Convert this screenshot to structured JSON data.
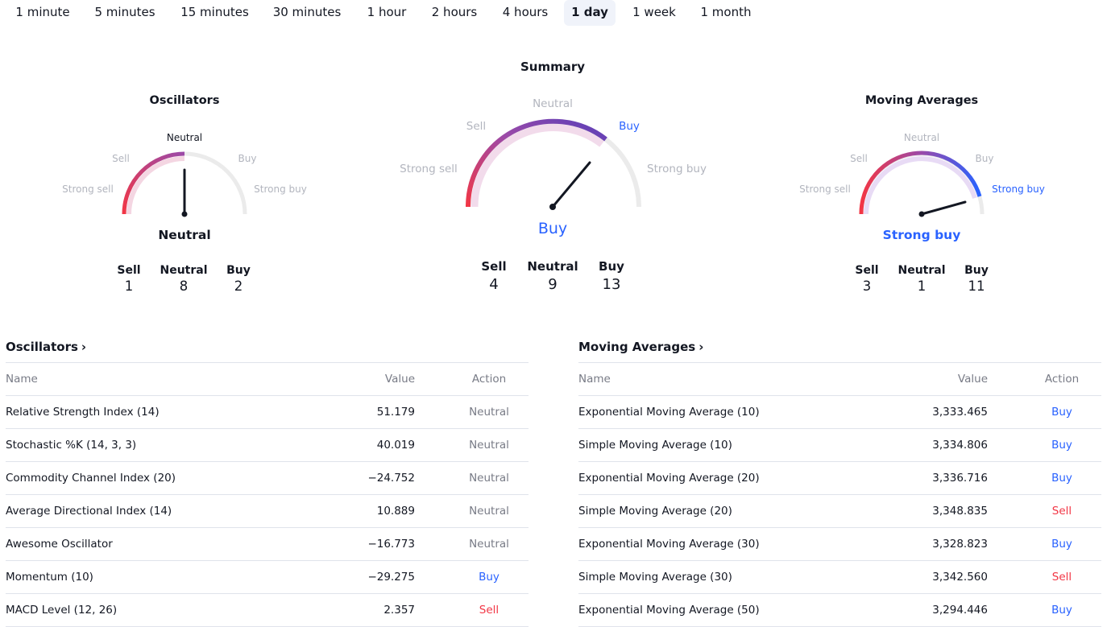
{
  "timeframes": {
    "items": [
      "1 minute",
      "5 minutes",
      "15 minutes",
      "30 minutes",
      "1 hour",
      "2 hours",
      "4 hours",
      "1 day",
      "1 week",
      "1 month"
    ],
    "active": "1 day"
  },
  "gauges": {
    "oscillators": {
      "title": "Oscillators",
      "labels": {
        "strong_sell": "Strong sell",
        "sell": "Sell",
        "neutral": "Neutral",
        "buy": "Buy",
        "strong_buy": "Strong buy"
      },
      "verdict": "Neutral",
      "counts": {
        "sell_label": "Sell",
        "neutral_label": "Neutral",
        "buy_label": "Buy",
        "sell": "1",
        "neutral": "8",
        "buy": "2"
      }
    },
    "summary": {
      "title": "Summary",
      "labels": {
        "strong_sell": "Strong sell",
        "sell": "Sell",
        "neutral": "Neutral",
        "buy": "Buy",
        "strong_buy": "Strong buy"
      },
      "verdict": "Buy",
      "counts": {
        "sell_label": "Sell",
        "neutral_label": "Neutral",
        "buy_label": "Buy",
        "sell": "4",
        "neutral": "9",
        "buy": "13"
      }
    },
    "moving_averages": {
      "title": "Moving Averages",
      "labels": {
        "strong_sell": "Strong sell",
        "sell": "Sell",
        "neutral": "Neutral",
        "buy": "Buy",
        "strong_buy": "Strong buy"
      },
      "verdict": "Strong buy",
      "counts": {
        "sell_label": "Sell",
        "neutral_label": "Neutral",
        "buy_label": "Buy",
        "sell": "3",
        "neutral": "1",
        "buy": "11"
      }
    }
  },
  "oscillators_table": {
    "title": "Oscillators",
    "chevron": "›",
    "headers": {
      "name": "Name",
      "value": "Value",
      "action": "Action"
    },
    "rows": [
      {
        "name": "Relative Strength Index (14)",
        "value": "51.179",
        "action": "Neutral"
      },
      {
        "name": "Stochastic %K (14, 3, 3)",
        "value": "40.019",
        "action": "Neutral"
      },
      {
        "name": "Commodity Channel Index (20)",
        "value": "−24.752",
        "action": "Neutral"
      },
      {
        "name": "Average Directional Index (14)",
        "value": "10.889",
        "action": "Neutral"
      },
      {
        "name": "Awesome Oscillator",
        "value": "−16.773",
        "action": "Neutral"
      },
      {
        "name": "Momentum (10)",
        "value": "−29.275",
        "action": "Buy"
      },
      {
        "name": "MACD Level (12, 26)",
        "value": "2.357",
        "action": "Sell"
      }
    ]
  },
  "moving_averages_table": {
    "title": "Moving Averages",
    "chevron": "›",
    "headers": {
      "name": "Name",
      "value": "Value",
      "action": "Action"
    },
    "rows": [
      {
        "name": "Exponential Moving Average (10)",
        "value": "3,333.465",
        "action": "Buy"
      },
      {
        "name": "Simple Moving Average (10)",
        "value": "3,334.806",
        "action": "Buy"
      },
      {
        "name": "Exponential Moving Average (20)",
        "value": "3,336.716",
        "action": "Buy"
      },
      {
        "name": "Simple Moving Average (20)",
        "value": "3,348.835",
        "action": "Sell"
      },
      {
        "name": "Exponential Moving Average (30)",
        "value": "3,328.823",
        "action": "Buy"
      },
      {
        "name": "Simple Moving Average (30)",
        "value": "3,342.560",
        "action": "Sell"
      },
      {
        "name": "Exponential Moving Average (50)",
        "value": "3,294.446",
        "action": "Buy"
      }
    ]
  },
  "colors": {
    "buy": "#2962ff",
    "sell": "#f23645",
    "neutral": "#787b86",
    "needle": "#131722",
    "track": "#e8e8e8"
  }
}
